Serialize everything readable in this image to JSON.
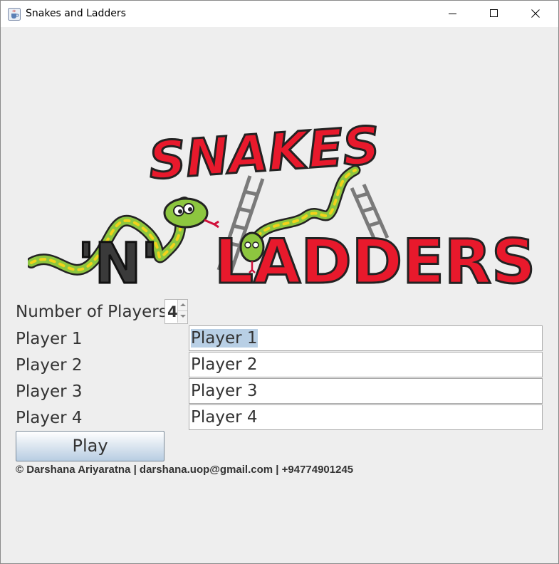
{
  "window": {
    "title": "Snakes and Ladders",
    "icon": "java-cup-icon"
  },
  "logo": {
    "line1": "SNAKES",
    "line2": "'N'",
    "line3": "LADDERS"
  },
  "form": {
    "num_players_label": "Number of Players",
    "num_players_value": "4",
    "players": [
      {
        "label": "Player 1",
        "value": "Player 1"
      },
      {
        "label": "Player 2",
        "value": "Player 2"
      },
      {
        "label": "Player 3",
        "value": "Player 3"
      },
      {
        "label": "Player 4",
        "value": "Player 4"
      }
    ],
    "play_label": "Play"
  },
  "footer": {
    "text": "© Darshana Ariyaratna | darshana.uop@gmail.com | +94774901245"
  },
  "colors": {
    "logo_red": "#e8192c",
    "snake_green": "#8dc63f",
    "snake_yellow": "#f2d21a",
    "selection": "#b8cfe5"
  }
}
